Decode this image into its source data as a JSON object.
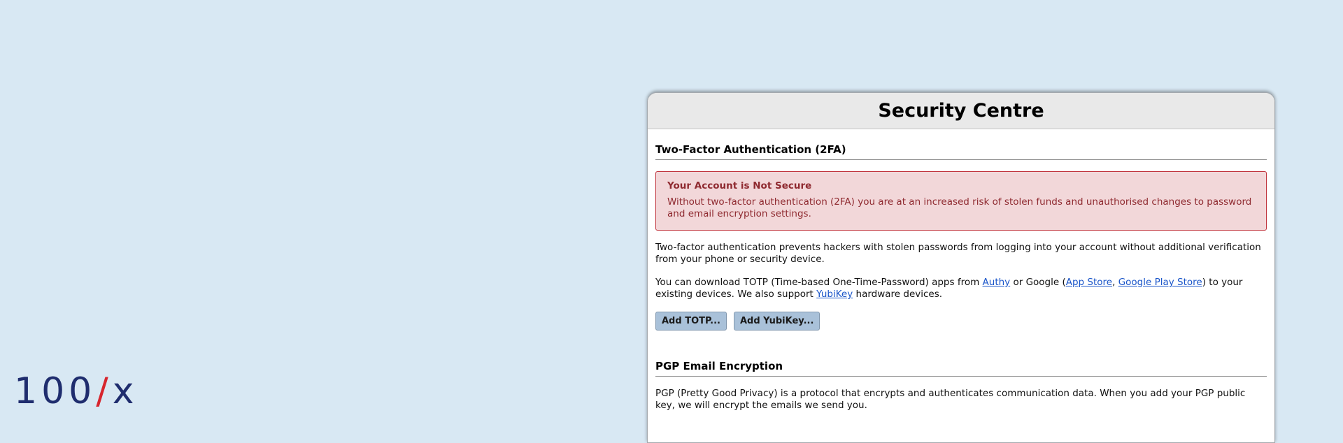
{
  "logo": {
    "digits": "100",
    "slash": "/",
    "letter": "x"
  },
  "security": {
    "title": "Security Centre",
    "two_factor": {
      "heading": "Two-Factor Authentication (2FA)",
      "alert_title": "Your Account is Not Secure",
      "alert_text": "Without two-factor authentication (2FA) you are at an increased risk of stolen funds and unauthorised changes to password and email encryption settings.",
      "intro": "Two-factor authentication prevents hackers with stolen passwords from logging into your account without additional verification from your phone or security device.",
      "download_prefix": "You can download TOTP (Time-based One-Time-Password) apps from ",
      "authy_link": "Authy",
      "google_text": " or Google (",
      "app_store_link": "App Store",
      "comma": ", ",
      "play_store_link": "Google Play Store",
      "suffix": ") to your existing devices. We also support ",
      "yubikey_link": "YubiKey",
      "hardware_text": " hardware devices.",
      "add_totp_button": "Add TOTP...",
      "add_yubikey_button": "Add YubiKey..."
    },
    "pgp": {
      "heading": "PGP Email Encryption",
      "text": "PGP (Pretty Good Privacy) is a protocol that encrypts and authenticates communication data. When you add your PGP public key, we will encrypt the emails we send you."
    }
  },
  "colors": {
    "background": "#d8e8f3",
    "alert_bg": "#f2d7d9",
    "alert_border": "#c0323b",
    "alert_text": "#8f2a30",
    "link": "#1a55c9",
    "button_bg": "#a9c1d9",
    "logo_blue": "#1f2d6e",
    "logo_red": "#d7262e"
  }
}
